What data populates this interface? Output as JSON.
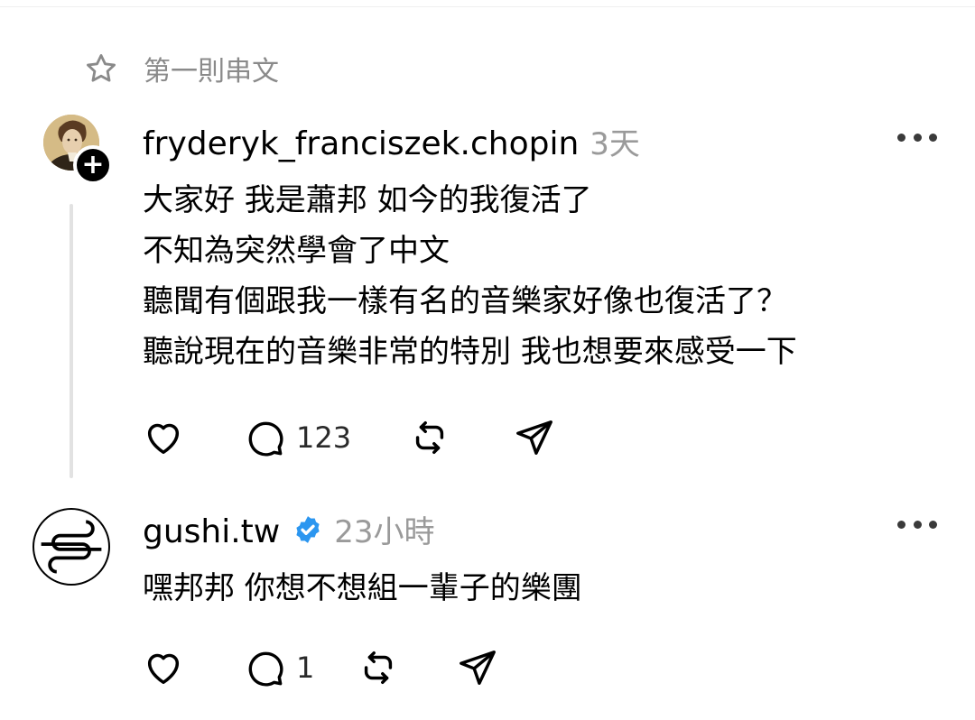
{
  "pinned": {
    "label": "第一則串文",
    "icon": "star-icon"
  },
  "posts": [
    {
      "username": "fryderyk_franciszek.chopin",
      "time": "3天",
      "verified": false,
      "lines": [
        "大家好 我是蕭邦  如今的我復活了",
        "不知為突然學會了中文",
        "聽聞有個跟我一樣有名的音樂家好像也復活了？",
        "聽說現在的音樂非常的特別 我也想要來感受一下"
      ],
      "reply_count": "123"
    },
    {
      "username": "gushi.tw",
      "time": "23小時",
      "verified": true,
      "lines": [
        "嘿邦邦 你想不想組一輩子的樂團"
      ],
      "reply_count": "1"
    }
  ],
  "colors": {
    "verified": "#2b96f0",
    "muted": "#9a9a9a",
    "thread_line": "#e2e2e2"
  }
}
